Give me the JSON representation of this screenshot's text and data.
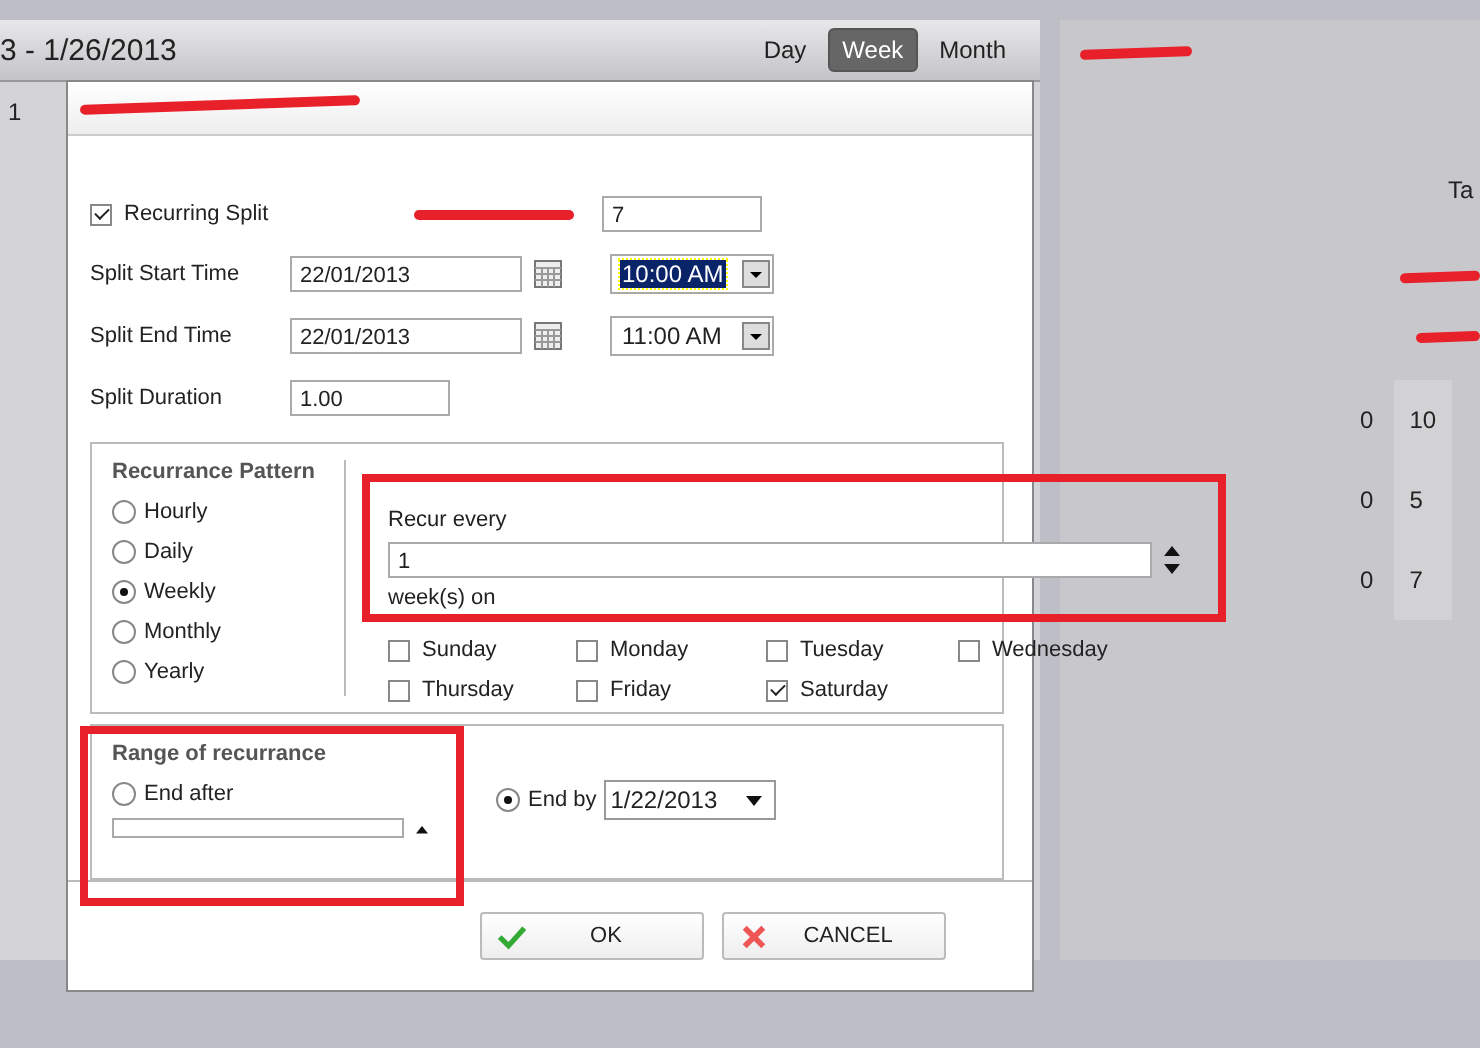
{
  "background": {
    "date_range": "3 - 1/26/2013",
    "views": [
      {
        "label": "Day",
        "selected": false
      },
      {
        "label": "Week",
        "selected": true
      },
      {
        "label": "Month",
        "selected": false
      }
    ],
    "row_number": "1",
    "side_label": "Ta",
    "column_a": [
      "0",
      "0",
      "0"
    ],
    "column_b": [
      "10",
      "5",
      "7"
    ]
  },
  "dialog": {
    "recurring_split": {
      "label": "Recurring Split",
      "checked": true
    },
    "redacted_field_value": "7",
    "start": {
      "label": "Split Start Time",
      "date": "22/01/2013",
      "time": "10:00 AM",
      "time_selected": true
    },
    "end": {
      "label": "Split End Time",
      "date": "22/01/2013",
      "time": "11:00 AM",
      "time_selected": false
    },
    "duration": {
      "label": "Split Duration",
      "value": "1.00"
    },
    "pattern": {
      "title": "Recurrance Pattern",
      "options": [
        {
          "label": "Hourly",
          "selected": false
        },
        {
          "label": "Daily",
          "selected": false
        },
        {
          "label": "Weekly",
          "selected": true
        },
        {
          "label": "Monthly",
          "selected": false
        },
        {
          "label": "Yearly",
          "selected": false
        }
      ],
      "recur_label": "Recur every",
      "recur_value": "1",
      "unit_label": "week(s) on",
      "days": [
        {
          "label": "Sunday",
          "checked": false
        },
        {
          "label": "Monday",
          "checked": false
        },
        {
          "label": "Tuesday",
          "checked": false
        },
        {
          "label": "Wednesday",
          "checked": false
        },
        {
          "label": "Thursday",
          "checked": false
        },
        {
          "label": "Friday",
          "checked": false
        },
        {
          "label": "Saturday",
          "checked": true
        }
      ]
    },
    "range": {
      "title": "Range of recurrance",
      "options": [
        {
          "label": "End after",
          "selected": false
        },
        {
          "label": "End by",
          "selected": true
        }
      ],
      "end_date": "1/22/2013"
    },
    "buttons": [
      {
        "kind": "ok",
        "label": "OK"
      },
      {
        "kind": "cancel",
        "label": "CANCEL"
      }
    ]
  }
}
